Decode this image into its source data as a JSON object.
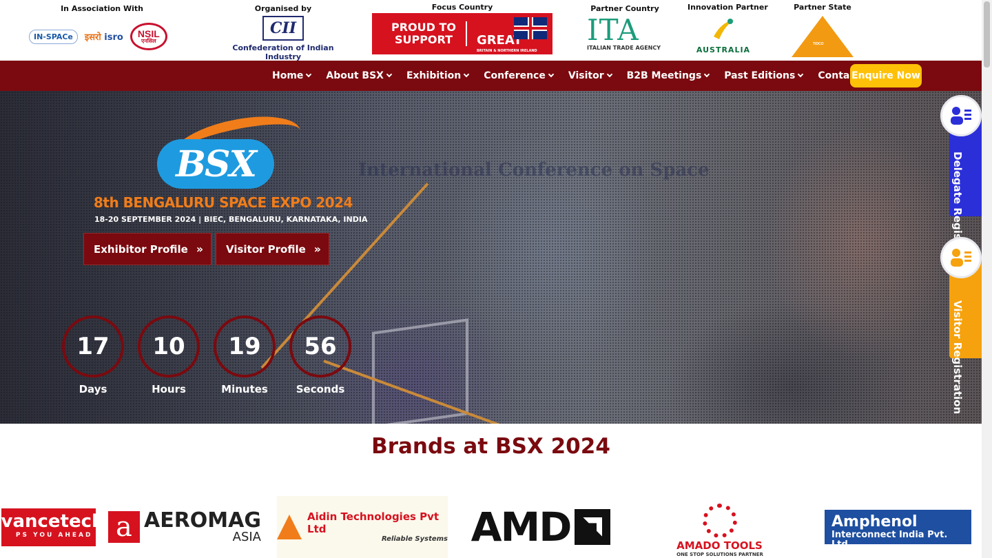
{
  "partners": {
    "association": {
      "caption": "In Association With",
      "inspace": "IN-SPACe",
      "isro_hindi": "इसरो",
      "isro": "isro",
      "nsil": "NSIL",
      "nsil_hindi": "एनसिल"
    },
    "organiser": {
      "caption": "Organised by",
      "logo": "CII",
      "name": "Confederation of Indian Industry"
    },
    "focus_country": {
      "caption": "Focus Country",
      "left_text": "PROUD TO SUPPORT",
      "right_text": "GREAT",
      "right_sub": "BRITAIN & NORTHERN IRELAND"
    },
    "partner_country": {
      "caption": "Partner Country",
      "logo": "ITA",
      "sub": "ITALIAN TRADE AGENCY"
    },
    "innovation_partner": {
      "caption": "Innovation Partner",
      "name": "AUSTRALIA"
    },
    "partner_state": {
      "caption": "Partner State",
      "logo": "TIDCO"
    }
  },
  "nav": {
    "items": [
      {
        "label": "Home"
      },
      {
        "label": "About BSX"
      },
      {
        "label": "Exhibition"
      },
      {
        "label": "Conference"
      },
      {
        "label": "Visitor"
      },
      {
        "label": "B2B Meetings"
      },
      {
        "label": "Past Editions"
      },
      {
        "label": "Contact Us"
      }
    ],
    "cta": "Enquire Now"
  },
  "hero": {
    "banner_text": "International Conference on Space",
    "logo": "BSX",
    "title": "8th BENGALURU SPACE EXPO 2024",
    "subtitle": "18-20 SEPTEMBER 2024 | BIEC, BENGALURU, KARNATAKA, INDIA",
    "exhibitor_btn": "Exhibitor Profile",
    "visitor_btn": "Visitor Profile",
    "countdown": [
      {
        "value": "17",
        "label": "Days"
      },
      {
        "value": "10",
        "label": "Hours"
      },
      {
        "value": "19",
        "label": "Minutes"
      },
      {
        "value": "56",
        "label": "Seconds"
      }
    ]
  },
  "side_tabs": {
    "delegate": "Delegate Registration",
    "visitor": "Visitor Registration",
    "delegate_color": "#2b2fd8",
    "visitor_color": "#f5a20e"
  },
  "brands": {
    "title": "Brands at BSX 2024",
    "items": [
      {
        "name": "vancetech",
        "tag": "PS YOU AHEAD"
      },
      {
        "name": "AEROMAG",
        "sub": "ASIA"
      },
      {
        "name": "Aidin Technologies Pvt Ltd",
        "sub": "Reliable Systems"
      },
      {
        "name": "AMD"
      },
      {
        "name": "AMADO TOOLS",
        "sub": "ONE STOP SOLUTIONS PARTNER"
      },
      {
        "name": "Amphenol",
        "sub": "Interconnect India Pvt. Ltd."
      }
    ]
  },
  "colors": {
    "brand_maroon": "#7a0a0f",
    "cta_yellow": "#ffc107",
    "bsx_orange": "#f07d1a",
    "bsx_blue": "#1e9be0"
  }
}
